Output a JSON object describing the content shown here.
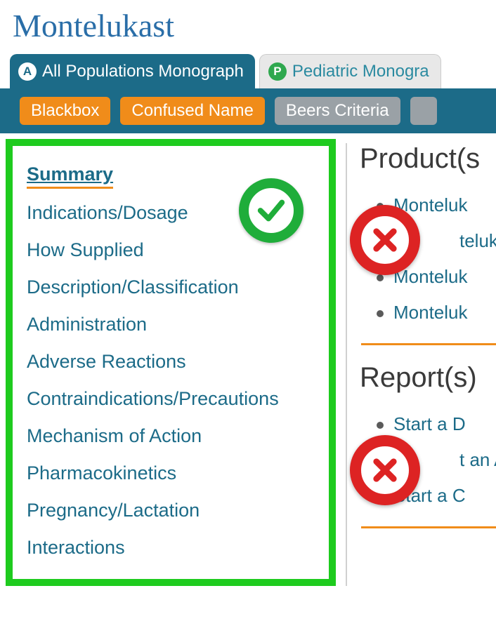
{
  "title": "Montelukast",
  "tabs": [
    {
      "badge": "A",
      "label": "All Populations Monograph",
      "active": true
    },
    {
      "badge": "P",
      "label": "Pediatric Monogra",
      "active": false
    }
  ],
  "pills": [
    {
      "label": "Blackbox",
      "style": "orange"
    },
    {
      "label": "Confused Name",
      "style": "orange"
    },
    {
      "label": "Beers Criteria",
      "style": "gray"
    }
  ],
  "nav": [
    {
      "label": "Summary",
      "active": true
    },
    {
      "label": "Indications/Dosage"
    },
    {
      "label": "How Supplied"
    },
    {
      "label": "Description/Classification"
    },
    {
      "label": "Administration"
    },
    {
      "label": "Adverse Reactions"
    },
    {
      "label": "Contraindications/Precautions"
    },
    {
      "label": "Mechanism of Action"
    },
    {
      "label": "Pharmacokinetics"
    },
    {
      "label": "Pregnancy/Lactation"
    },
    {
      "label": "Interactions"
    }
  ],
  "side": {
    "heading1": "Product(s",
    "products": [
      "Monteluk",
      "teluk",
      "Monteluk",
      "Monteluk"
    ],
    "heading2": "Report(s)",
    "reports": [
      "Start a D",
      "t an A",
      "Start a C"
    ]
  }
}
